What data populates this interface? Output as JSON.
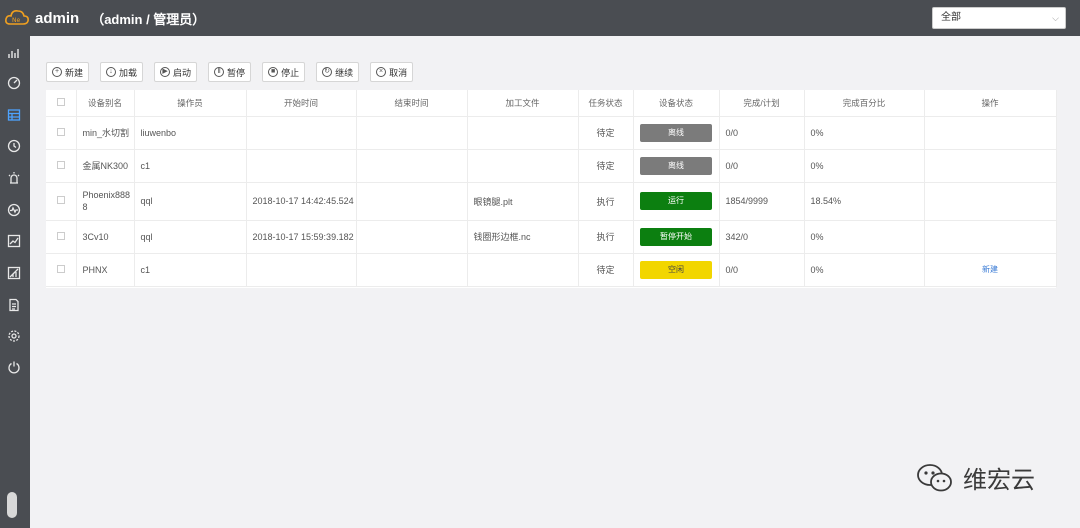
{
  "header": {
    "app_title": "admin",
    "role_text": "（admin / 管理员）",
    "filter_value": "全部"
  },
  "sidebar": {
    "items": [
      {
        "icon": "bar-chart-icon"
      },
      {
        "icon": "gauge-icon"
      },
      {
        "icon": "grid-table-icon"
      },
      {
        "icon": "clock-icon"
      },
      {
        "icon": "alarm-icon"
      },
      {
        "icon": "pulse-icon"
      },
      {
        "icon": "line-chart-icon"
      },
      {
        "icon": "report-chart-icon"
      },
      {
        "icon": "document-icon"
      },
      {
        "icon": "gear-icon"
      },
      {
        "icon": "power-icon"
      }
    ]
  },
  "toolbar": {
    "buttons": [
      {
        "label": "新建",
        "glyph": "+"
      },
      {
        "label": "加载",
        "glyph": "↓"
      },
      {
        "label": "启动",
        "glyph": "▶"
      },
      {
        "label": "暂停",
        "glyph": "Ⅱ"
      },
      {
        "label": "停止",
        "glyph": "■"
      },
      {
        "label": "继续",
        "glyph": "↻"
      },
      {
        "label": "取消",
        "glyph": "×"
      }
    ]
  },
  "table": {
    "headers": [
      "设备别名",
      "操作员",
      "开始时间",
      "结束时间",
      "加工文件",
      "任务状态",
      "设备状态",
      "完成/计划",
      "完成百分比",
      "操作"
    ],
    "rows": [
      {
        "alias": "min_水切割",
        "operator": "liuwenbo",
        "start": "",
        "end": "",
        "file": "",
        "task_status": "待定",
        "device_status": "离线",
        "status_kind": "offline",
        "progress": "0/0",
        "percent": "0%",
        "action": ""
      },
      {
        "alias": "金属NK300",
        "operator": "c1",
        "start": "",
        "end": "",
        "file": "",
        "task_status": "待定",
        "device_status": "离线",
        "status_kind": "offline",
        "progress": "0/0",
        "percent": "0%",
        "action": ""
      },
      {
        "alias": "Phoenix8888",
        "operator": "qql",
        "start": "2018-10-17 14:42:45.524",
        "end": "",
        "file": "眼镜腿.plt",
        "task_status": "执行",
        "device_status": "运行",
        "status_kind": "run",
        "progress": "1854/9999",
        "percent": "18.54%",
        "action": ""
      },
      {
        "alias": "3Cv10",
        "operator": "qql",
        "start": "2018-10-17 15:59:39.182",
        "end": "",
        "file": "钱圈形边框.nc",
        "task_status": "执行",
        "device_status": "暂停开始",
        "status_kind": "run",
        "progress": "342/0",
        "percent": "0%",
        "action": ""
      },
      {
        "alias": "PHNX",
        "operator": "c1",
        "start": "",
        "end": "",
        "file": "",
        "task_status": "待定",
        "device_status": "空闲",
        "status_kind": "idle",
        "progress": "0/0",
        "percent": "0%",
        "action": "新建"
      }
    ]
  },
  "watermark": {
    "text": "维宏云"
  },
  "colors": {
    "topbar": "#4a4d52",
    "offline": "#7b7b7b",
    "running": "#0c7f10",
    "idle": "#f2d600",
    "link": "#3a7bd5"
  }
}
